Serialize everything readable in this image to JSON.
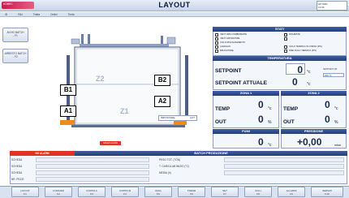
{
  "header": {
    "logo_text": "KOMEC",
    "title": "LAYOUT",
    "top_info_line1": "GP 0001",
    "top_info_line2": "13:06"
  },
  "menubar": [
    "ID",
    "RAI",
    "Tratta",
    "Ordini",
    "Tonfa"
  ],
  "side_buttons": [
    {
      "label": "AVVIO BATCH",
      "key": "- F1"
    },
    {
      "label": "ARRESTO BATCH",
      "key": "- F2"
    }
  ],
  "machine": {
    "zones": {
      "z2": "Z2",
      "z1": "Z1",
      "b1": "B1",
      "a1": "A1",
      "b2": "B2",
      "a2": "A2"
    },
    "dropdown_label": "IMPOSTARE",
    "dropdown_value": "AUT",
    "status_label": "SPEED ALARM"
  },
  "stati": {
    "title": "STATI",
    "left": [
      "VENT. ARIA COMBURENTE",
      "VENT. ASPIRATORE",
      "CICLO RISCALDAMENTO",
      "LAVAGGIO",
      "BRUCIATORE"
    ],
    "right": [
      "RICHIESTE",
      "",
      "CICLO TERMICO IN CORSO (P/S)",
      "FINE CICLO TERMICO (P/S)"
    ]
  },
  "temperatura": {
    "title": "TEMPERATURA",
    "setpoint_label": "SETPOINT",
    "setpoint_value": "0",
    "setpoint_unit": "°c",
    "actual_label": "SETPOINT ATTUALE",
    "actual_value": "0",
    "actual_unit": "°c",
    "side_note": "SETPOINT OP",
    "side_value": "100 °C"
  },
  "zona1": {
    "title": "ZONA 1",
    "temp_label": "TEMP",
    "temp_value": "0",
    "temp_unit": "°c",
    "out_label": "OUT",
    "out_value": "0",
    "out_unit": "%"
  },
  "zona2": {
    "title": "ZONA 2",
    "temp_label": "TEMP",
    "temp_value": "0",
    "temp_unit": "°c",
    "out_label": "OUT",
    "out_value": "0",
    "out_unit": "%"
  },
  "fumi": {
    "title": "FUMI",
    "value": "0",
    "unit": "°c"
  },
  "pressione": {
    "title": "PRESSIONE",
    "value": "+0,00",
    "unit": "mbar"
  },
  "batch": {
    "alarm_label": "NO ALARM",
    "title": "BATCH PRODUZIONE",
    "rows_left": [
      "SCHEDA",
      "SCHEDA",
      "SCHEDA",
      "NR. PEZZI"
    ],
    "rows_right": [
      "PESO TOT. (TON)",
      "T. CARICA AB INIZIO (°C)",
      "MEDIA (h)"
    ]
  },
  "fkeys": [
    {
      "label": "LAYOUT",
      "key": "F1"
    },
    {
      "label": "COMANDI",
      "key": "F2"
    },
    {
      "label": "COPPIA A",
      "key": "F3"
    },
    {
      "label": "COPPIA B",
      "key": "F4"
    },
    {
      "label": "DIAG",
      "key": "F5"
    },
    {
      "label": "TREND",
      "key": "F6"
    },
    {
      "label": "SET",
      "key": "F7"
    },
    {
      "label": "CICLI",
      "key": "F8"
    },
    {
      "label": "ALLARMI",
      "key": "F9"
    },
    {
      "label": "SERVIZI",
      "key": "F10"
    }
  ],
  "colors": {
    "accent": "#243e78",
    "alarm_bar": "#e2331e",
    "logo": "#c81d4e"
  }
}
